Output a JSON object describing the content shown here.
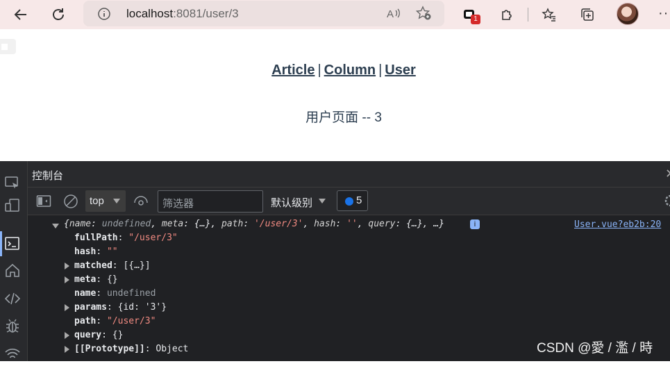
{
  "browser": {
    "url_host": "localhost",
    "url_rest": ":8081/user/3",
    "extension_badge": "1"
  },
  "page": {
    "nav": [
      {
        "label": "Article"
      },
      {
        "label": "Column"
      },
      {
        "label": "User"
      }
    ],
    "separator": "|",
    "title": "用户页面 -- 3"
  },
  "devtools": {
    "tab_label": "控制台",
    "context": "top",
    "filter_placeholder": "筛选器",
    "level": "默认级别",
    "issues_count": "5",
    "source_link": "User.vue?eb2b:20",
    "summary": {
      "open": "{",
      "k1": "name",
      "v1": "undefined",
      "k2": "meta",
      "v2": "{…}",
      "k3": "path",
      "v3": "'/user/3'",
      "k4": "hash",
      "v4": "''",
      "k5": "query",
      "v5": "{…}",
      "close": "…}"
    },
    "info_chip": "i",
    "rows": [
      {
        "key": "fullPath",
        "value": "\"/user/3\"",
        "type": "string",
        "expandable": false
      },
      {
        "key": "hash",
        "value": "\"\"",
        "type": "string",
        "expandable": false
      },
      {
        "key": "matched",
        "value": "[{…}]",
        "type": "object",
        "expandable": true
      },
      {
        "key": "meta",
        "value": "{}",
        "type": "object",
        "expandable": true
      },
      {
        "key": "name",
        "value": "undefined",
        "type": "undefined",
        "expandable": false
      },
      {
        "key": "params",
        "value": "{id: '3'}",
        "type": "object",
        "expandable": true
      },
      {
        "key": "path",
        "value": "\"/user/3\"",
        "type": "string",
        "expandable": false
      },
      {
        "key": "query",
        "value": "{}",
        "type": "object",
        "expandable": true
      },
      {
        "key": "[[Prototype]]",
        "value": "Object",
        "type": "object",
        "expandable": true
      }
    ]
  },
  "watermark": "CSDN @愛 / 濫 / 時"
}
